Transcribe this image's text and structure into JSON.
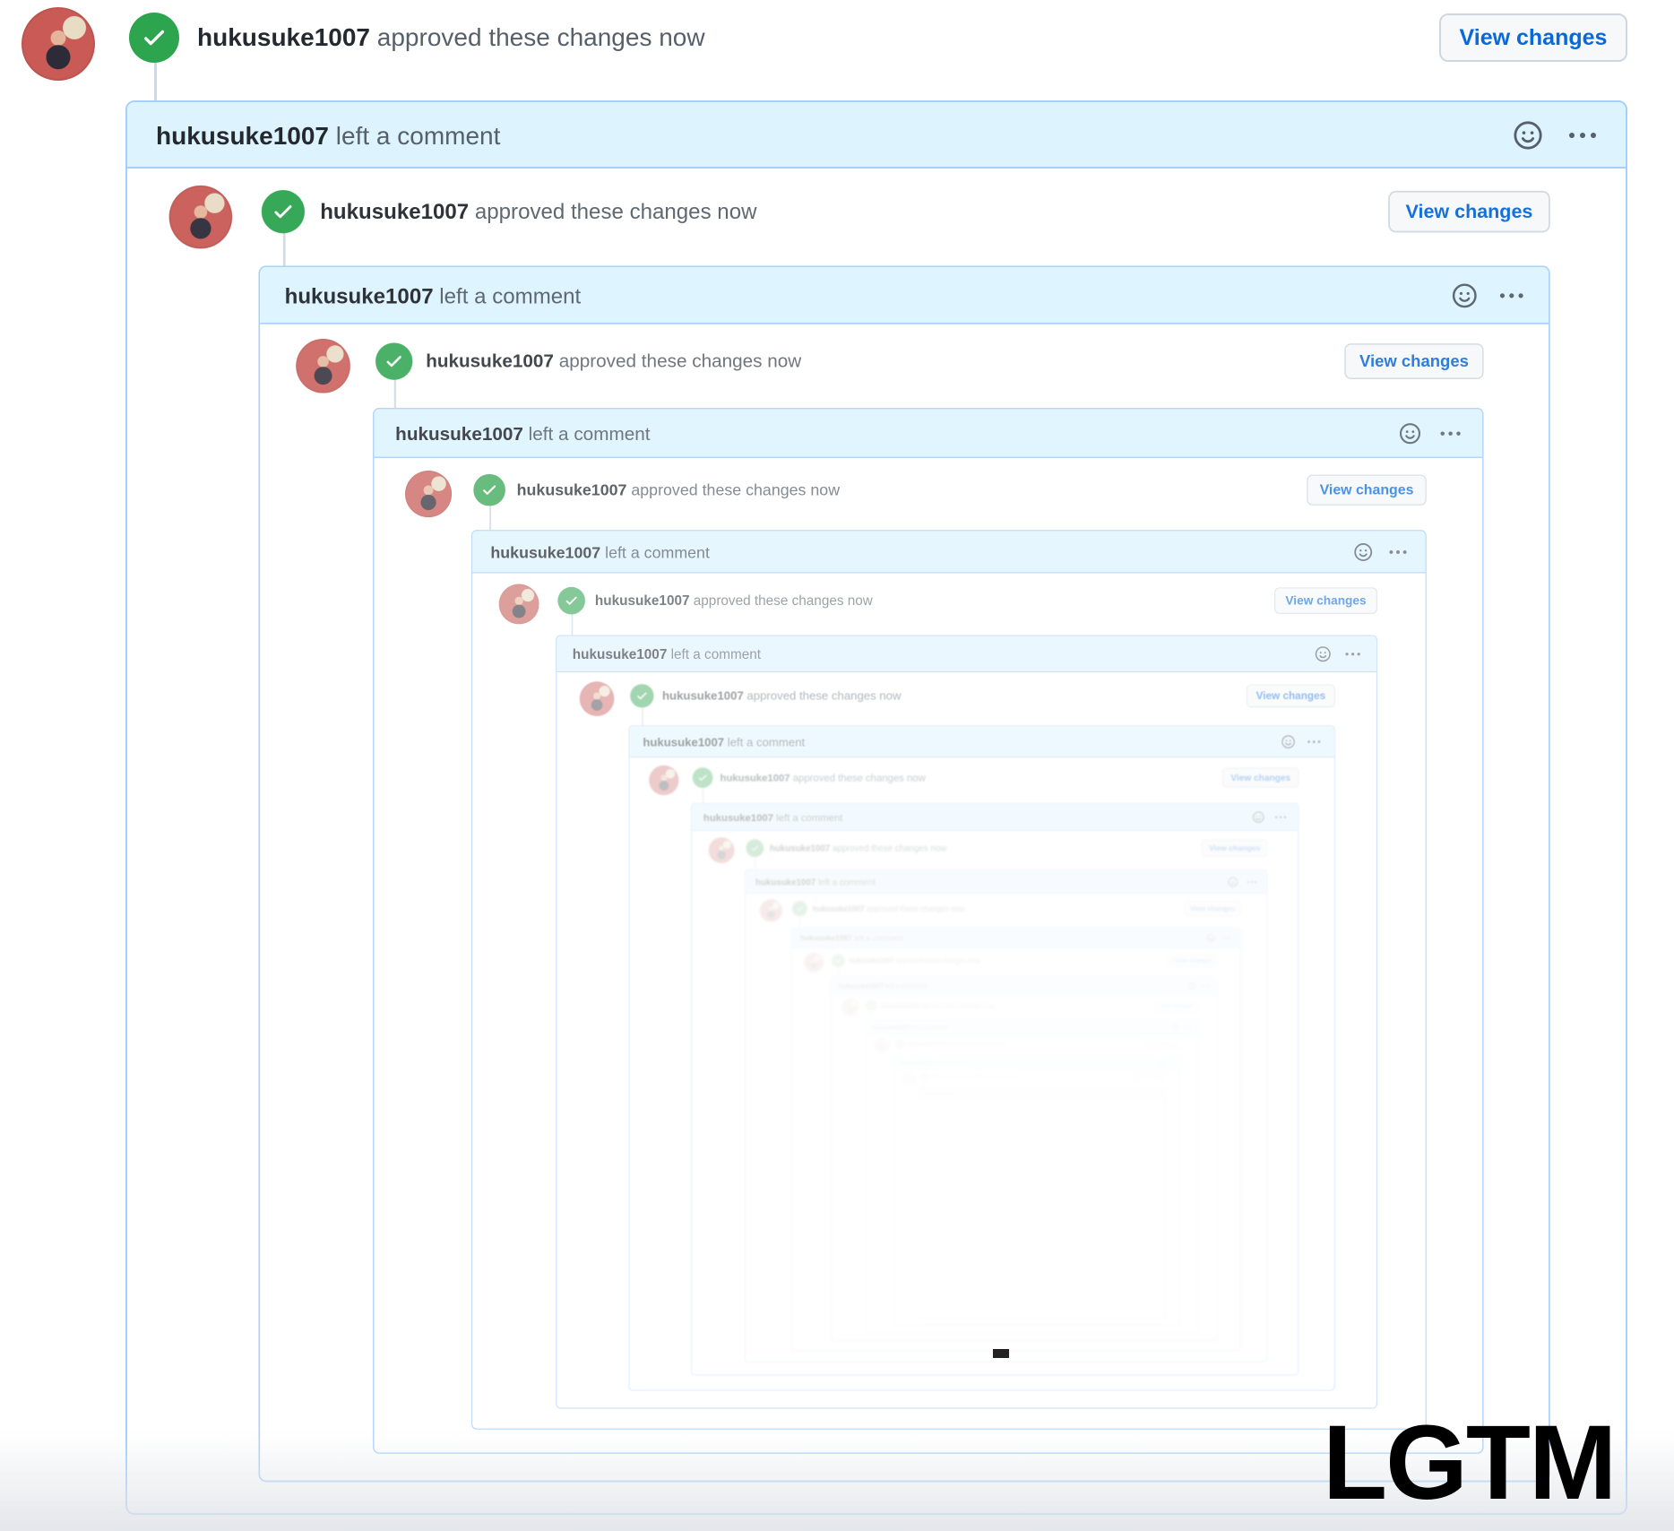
{
  "timeline": {
    "author": "hukusuke1007",
    "approved_text": "approved these changes now",
    "comment_text": "left a comment",
    "view_changes_label": "View changes"
  },
  "overlay": {
    "caption": "LGTM"
  },
  "icons": {
    "check": "check-circle-icon",
    "smiley": "smiley-icon",
    "menu": "kebab-horizontal-icon",
    "avatar": "user-avatar"
  },
  "colors": {
    "approved": "#2da44e",
    "link": "#0969da",
    "comment_header": "#ddf4ff",
    "comment_border": "#a6cffb"
  }
}
